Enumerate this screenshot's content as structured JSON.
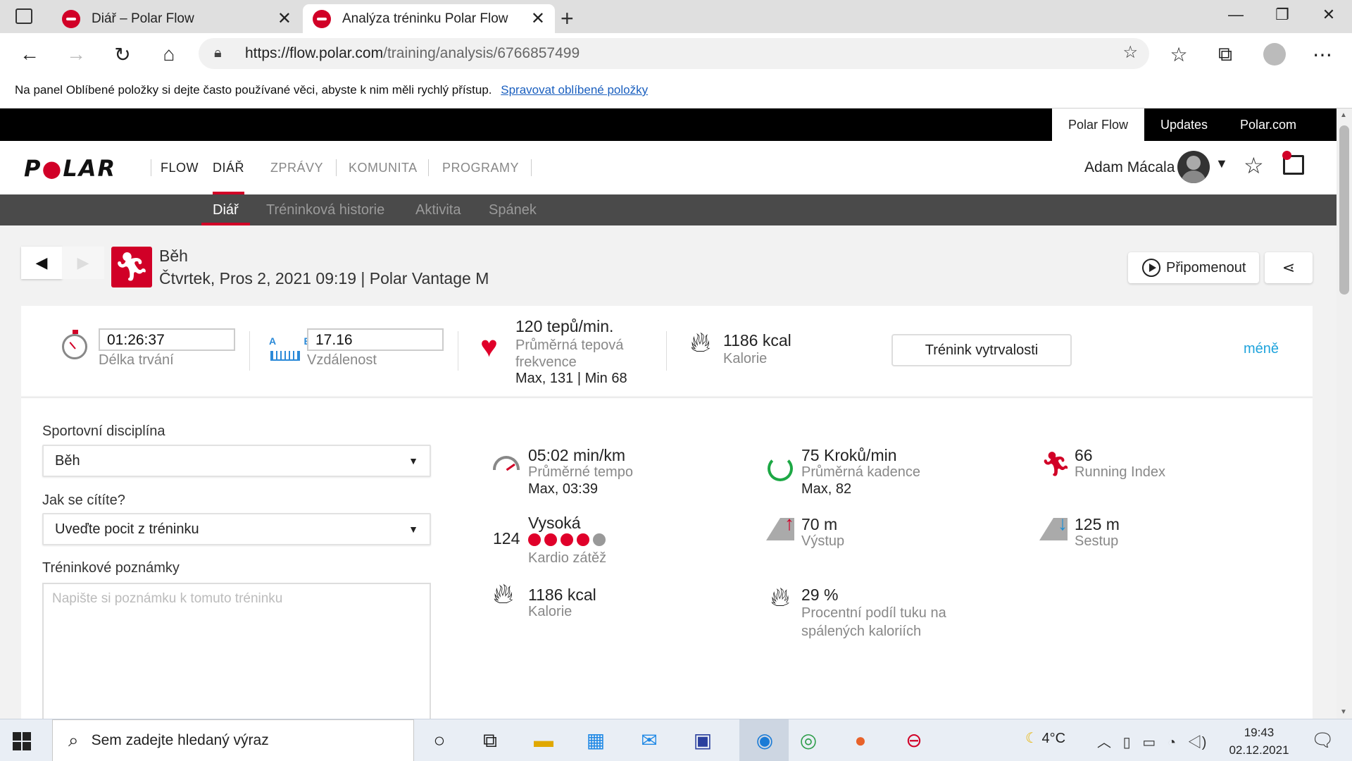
{
  "browser": {
    "tabs": [
      {
        "title": "Diář – Polar Flow"
      },
      {
        "title": "Analýza tréninku Polar Flow"
      }
    ],
    "url_host": "https://flow.polar.com",
    "url_path": "/training/analysis/6766857499",
    "favorites_bar_text": "Na panel Oblíbené položky si dejte často používané věci, abyste k nim měli rychlý přístup.",
    "favorites_bar_link": "Spravovat oblíbené položky"
  },
  "topnav": {
    "polar_flow": "Polar Flow",
    "updates": "Updates",
    "polar_com": "Polar.com"
  },
  "mainnav": {
    "logo": "POLAR",
    "flow": "FLOW",
    "items": [
      "DIÁŘ",
      "ZPRÁVY",
      "KOMUNITA",
      "PROGRAMY"
    ],
    "user": "Adam Mácala"
  },
  "subnav": {
    "items": [
      "Diář",
      "Tréninková historie",
      "Aktivita",
      "Spánek"
    ]
  },
  "training": {
    "sport": "Běh",
    "date_line": "Čtvrtek, Pros 2, 2021 09:19 | Polar Vantage M",
    "remind_label": "Připomenout"
  },
  "summary": {
    "duration_value": "01:26:37",
    "duration_label": "Délka trvání",
    "ab_label": "A B",
    "distance_value": "17.16",
    "distance_label": "Vzdálenost",
    "hr_value": "120 tepů/min.",
    "hr_label": "Průměrná tepová frekvence",
    "hr_minmax": "Max, 131  |  Min 68",
    "kcal_value": "1186 kcal",
    "kcal_label": "Kalorie",
    "type_button": "Trénink vytrvalosti",
    "less_link": "méně"
  },
  "form": {
    "sport_label": "Sportovní disciplína",
    "sport_value": "Běh",
    "feel_label": "Jak se cítíte?",
    "feel_value": "Uveďte pocit z tréninku",
    "notes_label": "Tréninkové poznámky",
    "notes_placeholder": "Napište si poznámku k tomuto tréninku"
  },
  "metrics": {
    "pace_value": "05:02 min/km",
    "pace_label": "Průměrné tempo",
    "pace_sub": "Max, 03:39",
    "cadence_value": "75 Kroků/min",
    "cadence_label": "Průměrná kadence",
    "cadence_sub": "Max, 82",
    "running_index_value": "66",
    "running_index_label": "Running Index",
    "load_number": "124",
    "load_value": "Vysoká",
    "load_dots_filled": 4,
    "load_dots_total": 5,
    "load_label": "Kardio zátěž",
    "ascent_value": "70 m",
    "ascent_label": "Výstup",
    "descent_value": "125 m",
    "descent_label": "Sestup",
    "kcal_value": "1186 kcal",
    "kcal_label": "Kalorie",
    "fat_value": "29 %",
    "fat_label": "Procentní podíl tuku na spálených kaloriích"
  },
  "taskbar": {
    "search_placeholder": "Sem zadejte hledaný výraz",
    "temperature": "4°C",
    "time": "19:43",
    "date": "02.12.2021"
  },
  "colors": {
    "brand_red": "#d10027",
    "link_blue": "#1ea3dc",
    "nav_dark": "#4a4a4a"
  }
}
